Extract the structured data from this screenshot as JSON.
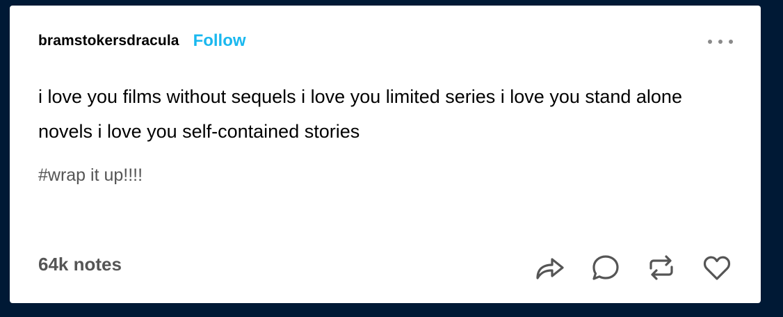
{
  "post": {
    "username": "bramstokersdracula",
    "follow_label": "Follow",
    "text": "i love you films without sequels i love you limited series i love you stand alone novels i love you self-contained stories",
    "tags": "#wrap it up!!!!",
    "notes": "64k notes"
  },
  "icons": {
    "more": "more-horizontal-icon",
    "share": "share-icon",
    "reply": "reply-icon",
    "reblog": "reblog-icon",
    "like": "heart-icon"
  },
  "colors": {
    "background": "#001935",
    "card": "#ffffff",
    "follow": "#1ab8ef",
    "muted": "#555555"
  }
}
